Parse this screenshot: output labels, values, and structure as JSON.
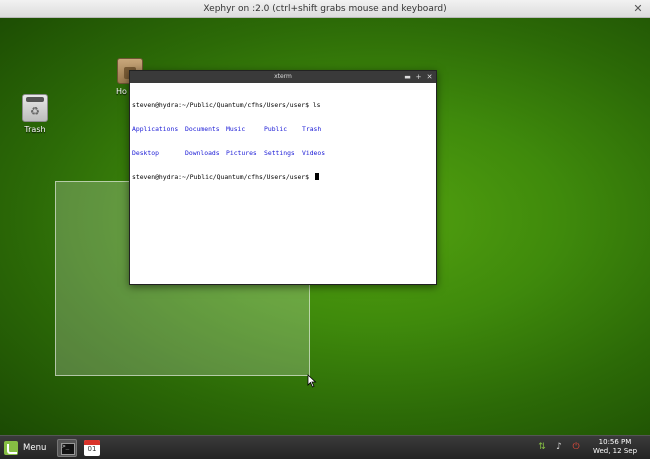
{
  "outer_window": {
    "title": "Xephyr on :2.0 (ctrl+shift grabs mouse and keyboard)",
    "close_glyph": "✕"
  },
  "desktop": {
    "icons": {
      "trash_label": "Trash",
      "home_label": "Ho"
    }
  },
  "xterm": {
    "title": "xterm",
    "controls": {
      "minimize": "▬",
      "maximize": "+",
      "close": "✕"
    },
    "lines": {
      "cmd1": "steven@hydra:~/Public/Quantum/cfhs/Users/user$ ls",
      "prompt2": "steven@hydra:~/Public/Quantum/cfhs/Users/user$ "
    },
    "ls_rows": [
      [
        "Applications",
        "Documents",
        "Music",
        "Public",
        "Trash"
      ],
      [
        "Desktop",
        "Downloads",
        "Pictures",
        "Settings",
        "Videos"
      ]
    ]
  },
  "taskbar": {
    "menu_label": "Menu",
    "calendar_day": "01",
    "clock_time": "10:56 PM",
    "clock_date": "Wed, 12 Sep"
  },
  "icons": {
    "tray": [
      "network-icon",
      "volume-icon",
      "power-icon"
    ]
  }
}
